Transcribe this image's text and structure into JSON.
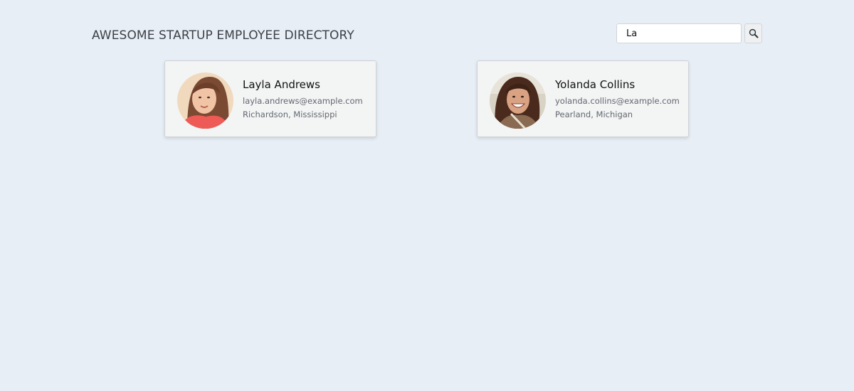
{
  "header": {
    "title": "AWESOME STARTUP EMPLOYEE DIRECTORY"
  },
  "search": {
    "value": "La",
    "button_icon": "search-icon"
  },
  "employees": [
    {
      "name": "Layla Andrews",
      "email": "layla.andrews@example.com",
      "location": "Richardson, Mississippi"
    },
    {
      "name": "Yolanda Collins",
      "email": "yolanda.collins@example.com",
      "location": "Pearland, Michigan"
    }
  ]
}
